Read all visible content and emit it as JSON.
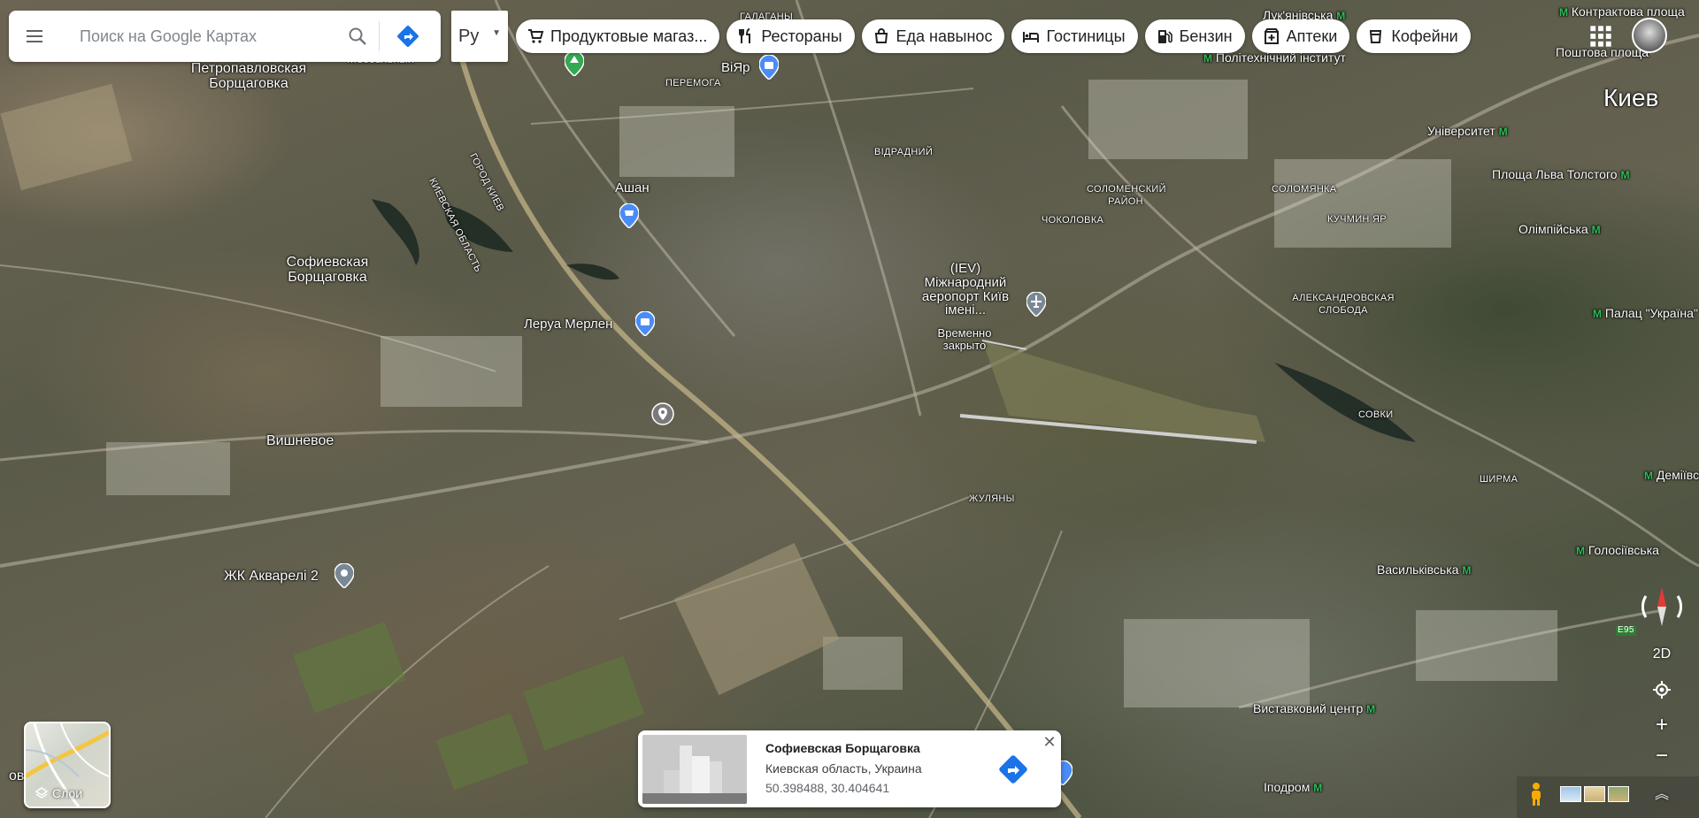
{
  "search": {
    "placeholder": "Поиск на Google Картах"
  },
  "language": {
    "selected": "Ру"
  },
  "chips": [
    {
      "label": "Продуктовые магаз...",
      "icon": "cart-icon"
    },
    {
      "label": "Рестораны",
      "icon": "fork-knife-icon"
    },
    {
      "label": "Еда навынос",
      "icon": "takeout-bag-icon"
    },
    {
      "label": "Гостиницы",
      "icon": "bed-icon"
    },
    {
      "label": "Бензин",
      "icon": "gas-pump-icon"
    },
    {
      "label": "Аптеки",
      "icon": "pharmacy-icon"
    },
    {
      "label": "Кофейни",
      "icon": "coffee-cup-icon"
    }
  ],
  "map_labels": {
    "kiev": "Киев",
    "petropavlovska": "Петропавловская Борщаговка",
    "sofiivska": "Софиевская Борщаговка",
    "vyshneve": "Вишневое",
    "akvareli": "ЖК Акварелі 2",
    "auchan": "Ашан",
    "leroy": "Леруа Мерлен",
    "viyar": "ВіЯр",
    "airport": "(IEV) Міжнародний аеропорт Київ імені...",
    "airport_status": "Временно закрыто",
    "peremoha": "ПЕРЕМОГА",
    "vidradnyi": "ВІДРАДНИЙ",
    "solomenskyi": "СОЛОМЕНСКИЙ РАЙОН",
    "chokolovka": "ЧОКОЛОВКА",
    "solomianka": "СОЛОМЯНКА",
    "kuchmin_yar": "КУЧМИН ЯР",
    "oleksandrivska": "АЛЕКСАНДРОВСКАЯ СЛОБОДА",
    "sovky": "СОВКИ",
    "shyrma": "ШИРМА",
    "zhuliany": "ЖУЛЯНЫ",
    "galagany": "ГАЛАГАНЫ",
    "lukianivska": "Лук'янівська",
    "kontraktova": "Контрактова площа",
    "poshtova": "Поштова площа",
    "polytechnic": "Політехнічний інститут",
    "universytet": "Університет",
    "lva_tolstoho": "Площа Льва Толстого",
    "olimpiiska": "Олімпійська",
    "palats_ukraina": "Палац \"Україна\"",
    "demiivska": "Деміївська",
    "holosiivska": "Голосіївська",
    "vasylkivska": "Васильківська",
    "vystavkovyi": "Виставковий центр",
    "ipodrom": "Іподром",
    "bovshchyna": "овщина",
    "road_kiev_city": "ГОРОД КИЕВ",
    "road_kiev_obl": "КИЕВСКАЯ ОБЛАСТЬ",
    "road_e95": "E95",
    "mystery_top": "Мессельныи"
  },
  "controls": {
    "mode_2d": "2D",
    "layers_label": "Слои"
  },
  "info_card": {
    "title": "Софиевская Борщаговка",
    "subtitle": "Киевская область, Украина",
    "coords": "50.398488, 30.404641"
  },
  "colors": {
    "accent_blue": "#4285f4",
    "pin_blue": "#4a8cf7",
    "metro_green": "#2ebd59",
    "compass_red": "#e53935"
  }
}
